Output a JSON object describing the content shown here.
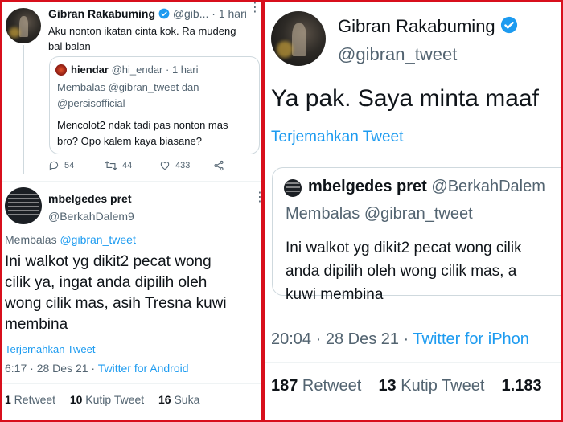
{
  "left": {
    "tweet1": {
      "name": "Gibran Rakabuming",
      "handle": "@gib...",
      "time": "· 1 hari",
      "text_line1": "Aku nonton ikatan cinta kok. Ra mudeng",
      "text_line2": "bal balan",
      "quoted": {
        "name": "hiendar",
        "handle": "@hi_endar",
        "time": "· 1 hari",
        "reply_to_line1": "Membalas @gibran_tweet dan",
        "reply_to_line2": "@persisofficial",
        "text_line1": "Mencolot2 ndak tadi pas nonton mas",
        "text_line2": "bro? Opo kalem kaya biasane?"
      },
      "stats": {
        "replies": "54",
        "retweets": "44",
        "likes": "433"
      }
    },
    "tweet2": {
      "name": "mbelgedes pret",
      "handle": "@BerkahDalem9",
      "reply_prefix": "Membalas ",
      "reply_handle": "@gibran_tweet",
      "text_line1": "Ini walkot yg dikit2 pecat wong",
      "text_line2": "cilik ya, ingat anda dipilih oleh",
      "text_line3": "wong cilik mas, asih Tresna kuwi",
      "text_line4": "membina",
      "translate": "Terjemahkan Tweet",
      "timestamp": "6:17 · 28 Des 21 · ",
      "source": "Twitter for Android",
      "retweets_count": "1",
      "retweets_label": " Retweet",
      "quotes_count": "10",
      "quotes_label": " Kutip Tweet",
      "likes_count": "16",
      "likes_label": " Suka"
    }
  },
  "right": {
    "name": "Gibran Rakabuming",
    "handle": "@gibran_tweet",
    "text": "Ya pak. Saya minta maaf",
    "translate": "Terjemahkan Tweet",
    "quoted": {
      "name": "mbelgedes pret",
      "handle": "@BerkahDalem",
      "reply_to": "Membalas @gibran_tweet",
      "text_line1": "Ini walkot yg dikit2 pecat wong cilik",
      "text_line2": "anda dipilih oleh wong cilik mas, a",
      "text_line3": "kuwi membina"
    },
    "timestamp": "20:04 · 28 Des 21 · ",
    "source": "Twitter for iPhon",
    "retweets_count": "187",
    "retweets_label": " Retweet",
    "quotes_count": "13",
    "quotes_label": " Kutip Tweet",
    "likes_count": "1.183"
  },
  "colors": {
    "border": "#d80f1c",
    "link": "#1d9bf0",
    "verified": "#1d9bf0",
    "muted": "#536471"
  }
}
